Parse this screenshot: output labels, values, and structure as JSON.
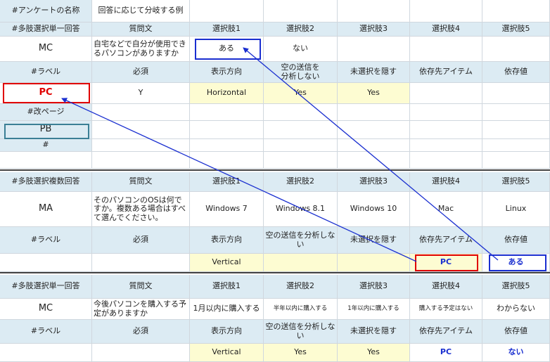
{
  "colors": {
    "header_bg": "#dcebf3",
    "highlight_bg": "#fdfcd2",
    "red_box": "#e00000",
    "blue_box": "#1a2fd0",
    "teal_box": "#3b7f95",
    "arrow": "#1a2fd0"
  },
  "sheet": {
    "title_label": "#アンケートの名称",
    "title_value": "回答に応じて分岐する例",
    "block1": {
      "header": [
        "#多肢選択単一回答",
        "質問文",
        "選択肢1",
        "選択肢2",
        "選択肢3",
        "選択肢4",
        "選択肢5"
      ],
      "row": [
        "MC",
        "自宅などで自分が使用できるパソコンがありますか",
        "ある",
        "ない",
        "",
        "",
        ""
      ],
      "header2": [
        "#ラベル",
        "必須",
        "表示方向",
        "空の送信を\n分析しない",
        "未選択を隠す",
        "依存先アイテム",
        "依存値"
      ],
      "row2": [
        "PC",
        "Y",
        "Horizontal",
        "Yes",
        "Yes",
        "",
        ""
      ]
    },
    "pagebreak": {
      "label": "#改ページ",
      "value": "PB",
      "end": "#"
    },
    "block2": {
      "header": [
        "#多肢選択複数回答",
        "質問文",
        "選択肢1",
        "選択肢2",
        "選択肢3",
        "選択肢4",
        "選択肢5"
      ],
      "row": [
        "MA",
        "そのパソコンのOSは何ですか。複数ある場合はすべて選んでください。",
        "Windows 7",
        "Windows 8.1",
        "Windows 10",
        "Mac",
        "Linux"
      ],
      "header2": [
        "#ラベル",
        "必須",
        "表示方向",
        "空の送信を分析しない",
        "未選択を隠す",
        "依存先アイテム",
        "依存値"
      ],
      "row2": [
        "",
        "",
        "Vertical",
        "",
        "",
        "PC",
        "ある"
      ]
    },
    "block3": {
      "header": [
        "#多肢選択単一回答",
        "質問文",
        "選択肢1",
        "選択肢2",
        "選択肢3",
        "選択肢4",
        "選択肢5"
      ],
      "row": [
        "MC",
        "今後パソコンを購入する予定がありますか",
        "1月以内に購入する",
        "半年以内に購入する",
        "1年以内に購入する",
        "購入する予定はない",
        "わからない"
      ],
      "header2": [
        "#ラベル",
        "必須",
        "表示方向",
        "空の送信を分析しない",
        "未選択を隠す",
        "依存先アイテム",
        "依存値"
      ],
      "row2": [
        "",
        "",
        "Vertical",
        "Yes",
        "Yes",
        "PC",
        "ない"
      ]
    }
  }
}
